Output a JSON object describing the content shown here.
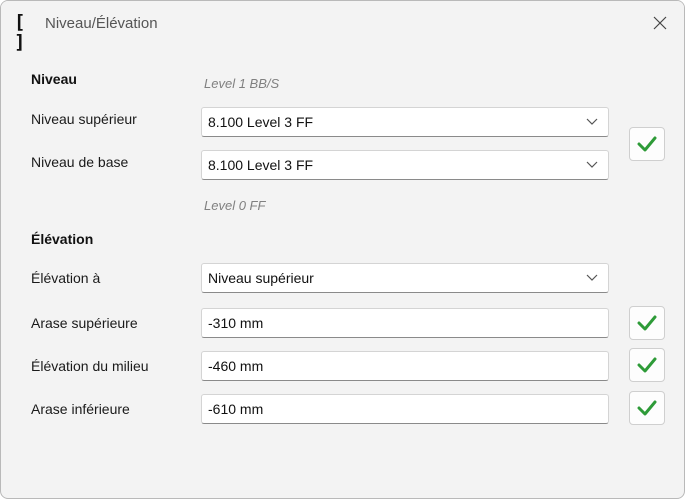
{
  "window": {
    "title": "Niveau/Élévation"
  },
  "level": {
    "header": "Niveau",
    "top_hint": "Level 1 BB/S",
    "upper_label": "Niveau supérieur",
    "upper_value": "8.100  Level 3 FF",
    "base_label": "Niveau de base",
    "base_value": "8.100  Level 3 FF",
    "bottom_hint": "Level 0 FF"
  },
  "elevation": {
    "header": "Élévation",
    "at_label": "Élévation à",
    "at_value": "Niveau supérieur",
    "top_label": "Arase supérieure",
    "top_value": "-310 mm",
    "middle_label": "Élévation du milieu",
    "middle_value": "-460 mm",
    "bottom_label": "Arase inférieure",
    "bottom_value": "-610 mm"
  },
  "icons": {
    "app": "bracket-icon",
    "close": "close-icon",
    "dropdown": "chevron-down-icon",
    "confirm": "checkmark-icon"
  },
  "colors": {
    "check": "#2e9b38"
  }
}
